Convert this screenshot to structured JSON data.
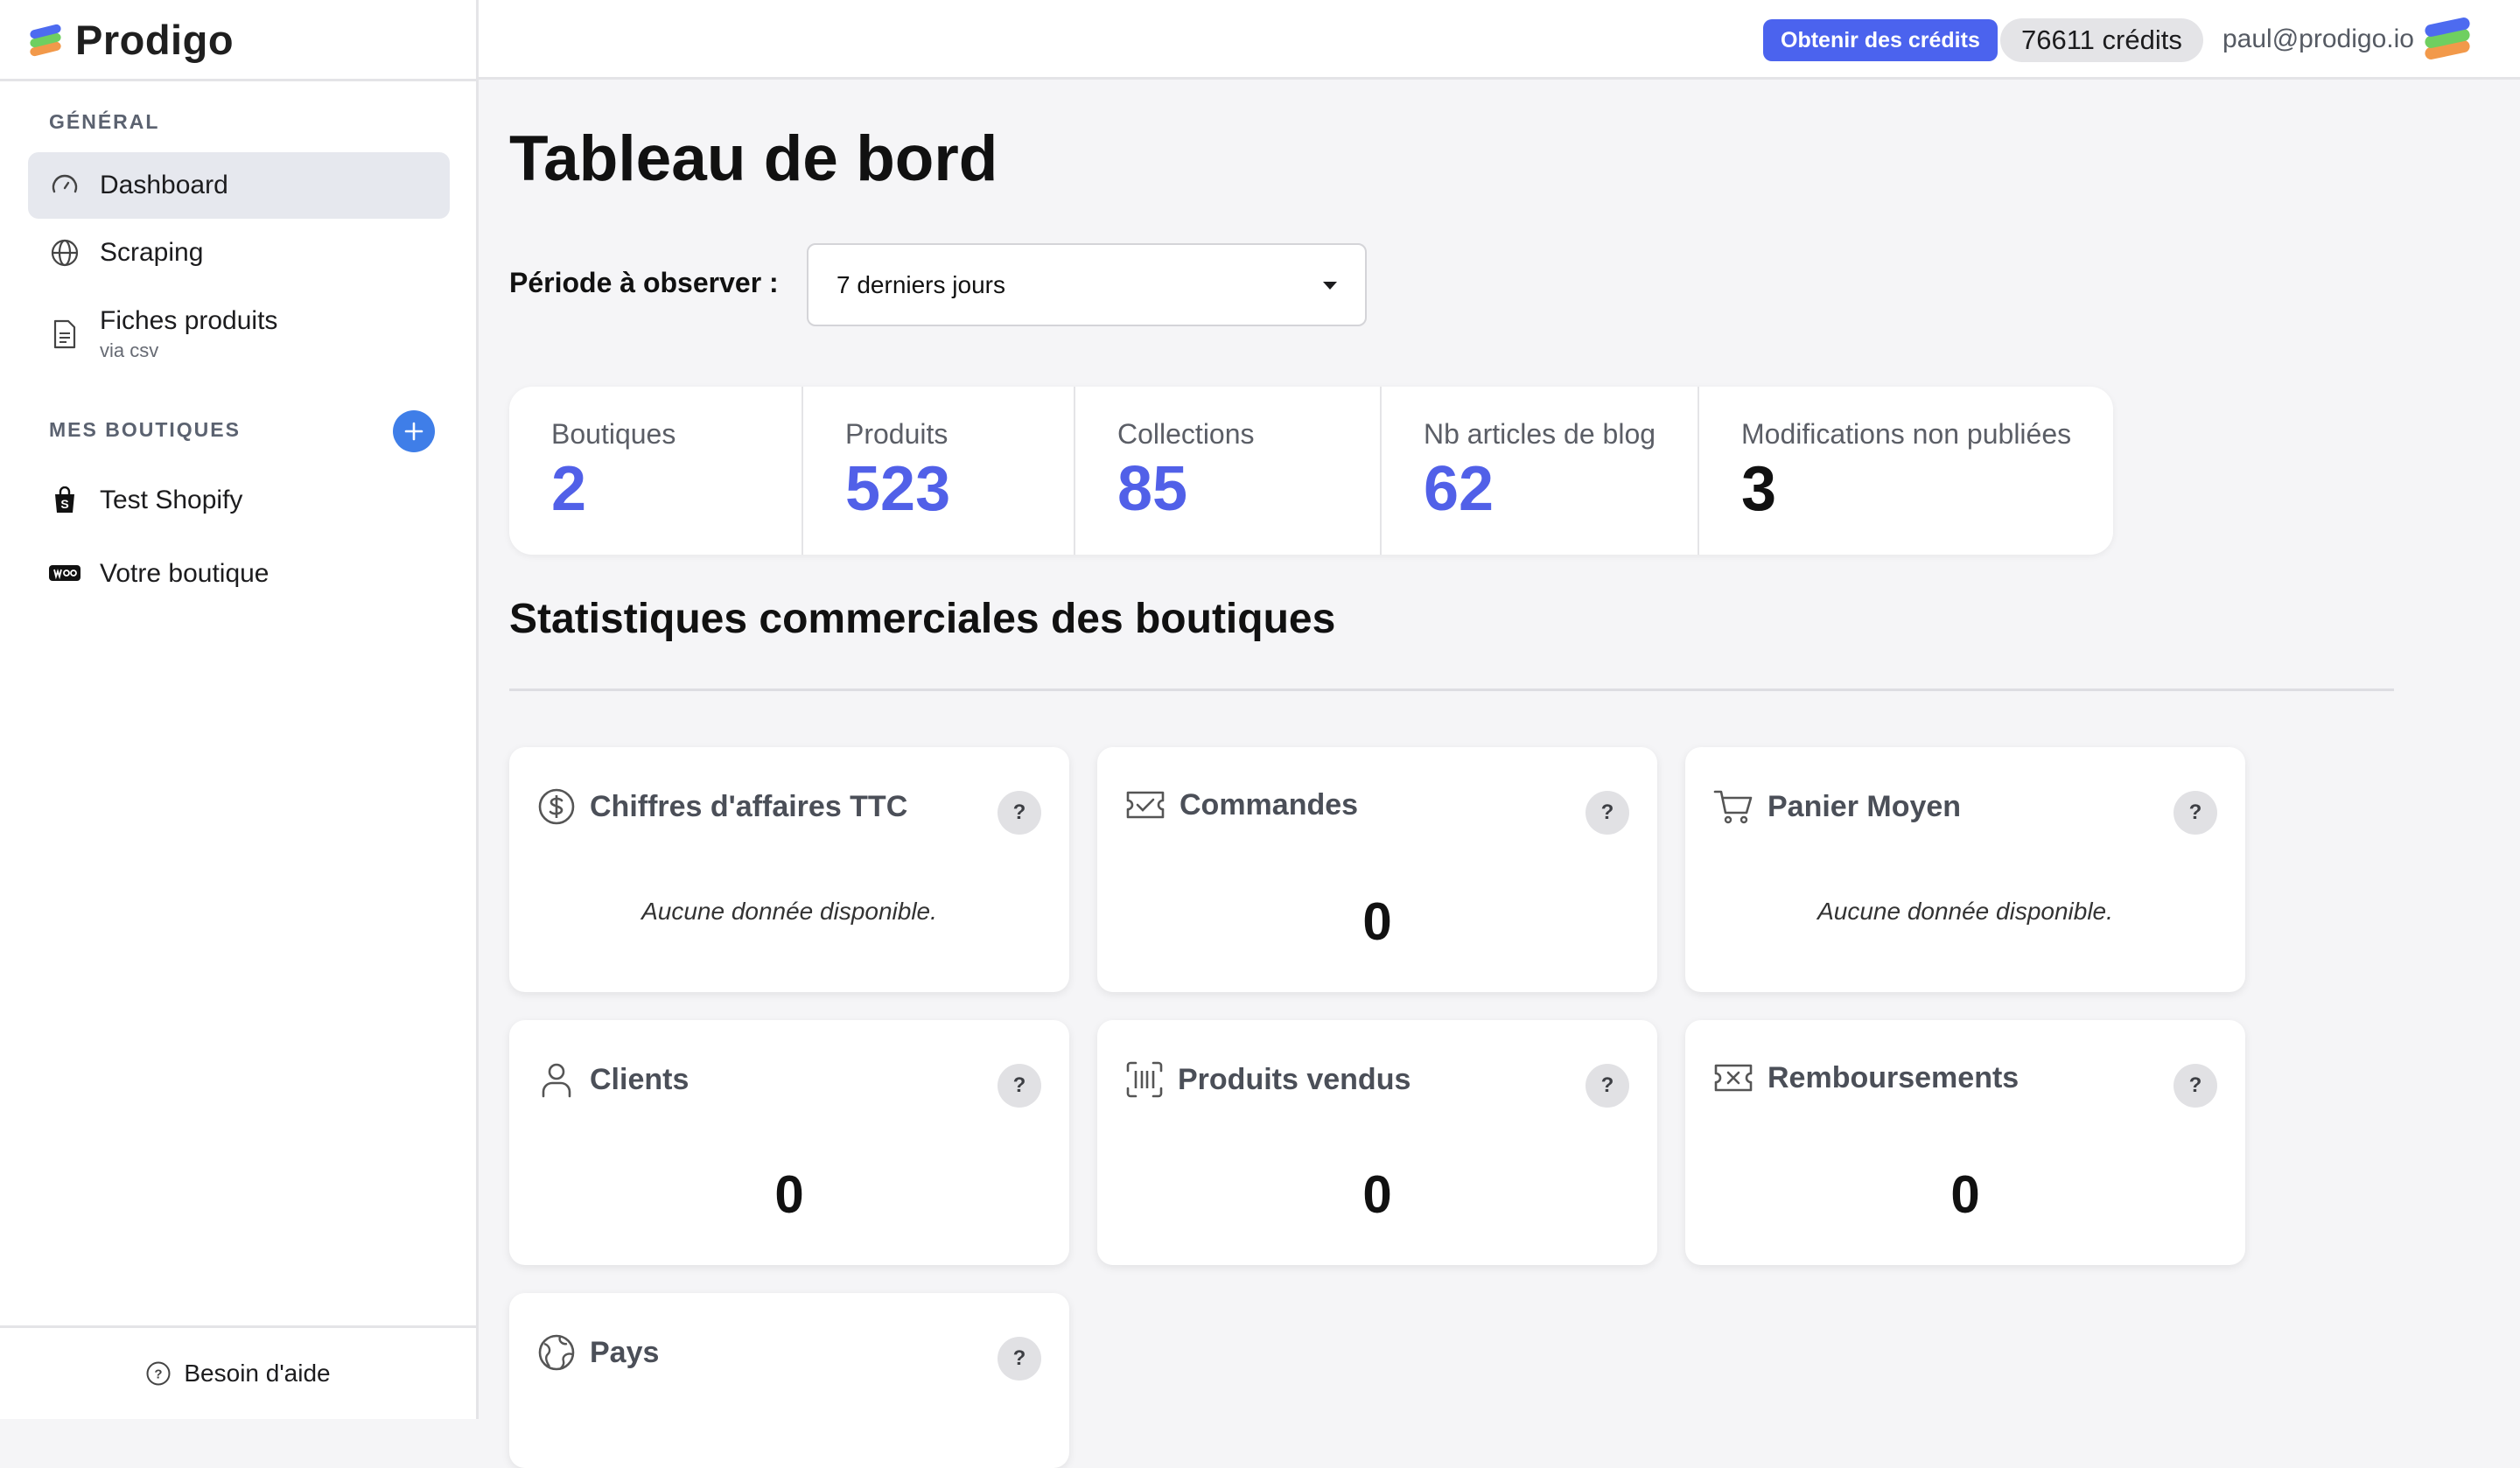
{
  "app": {
    "name": "Prodigo"
  },
  "sidebar": {
    "general_label": "GÉNÉRAL",
    "items": [
      {
        "label": "Dashboard",
        "icon": "gauge-icon",
        "active": true
      },
      {
        "label": "Scraping",
        "icon": "globe-icon"
      },
      {
        "label": "Fiches produits",
        "sub": "via csv",
        "icon": "document-icon"
      }
    ],
    "shops_label": "MES BOUTIQUES",
    "shops": [
      {
        "label": "Test Shopify",
        "icon": "shopify-bag-icon"
      },
      {
        "label": "Votre boutique",
        "icon": "woocommerce-icon"
      }
    ],
    "help_label": "Besoin d'aide"
  },
  "topbar": {
    "get_credits_label": "Obtenir des crédits",
    "credits_text": "76611 crédits",
    "user_email": "paul@prodigo.io"
  },
  "main": {
    "title": "Tableau de bord",
    "period_label": "Période à observer :",
    "period_value": "7 derniers jours",
    "stats": [
      {
        "label": "Boutiques",
        "value": "2"
      },
      {
        "label": "Produits",
        "value": "523"
      },
      {
        "label": "Collections",
        "value": "85"
      },
      {
        "label": "Nb articles de blog",
        "value": "62"
      },
      {
        "label": "Modifications non publiées",
        "value": "3"
      }
    ],
    "section_title": "Statistiques commerciales des boutiques",
    "cards": [
      {
        "title": "Chiffres d'affaires TTC",
        "icon": "dollar-circle-icon",
        "empty": "Aucune donnée disponible."
      },
      {
        "title": "Commandes",
        "icon": "ticket-check-icon",
        "value": "0"
      },
      {
        "title": "Panier Moyen",
        "icon": "cart-icon",
        "empty": "Aucune donnée disponible."
      },
      {
        "title": "Clients",
        "icon": "user-icon",
        "value": "0"
      },
      {
        "title": "Produits vendus",
        "icon": "barcode-scan-icon",
        "value": "0"
      },
      {
        "title": "Remboursements",
        "icon": "ticket-x-icon",
        "value": "0"
      },
      {
        "title": "Pays",
        "icon": "globe-grid-icon"
      }
    ],
    "help_glyph": "?"
  }
}
